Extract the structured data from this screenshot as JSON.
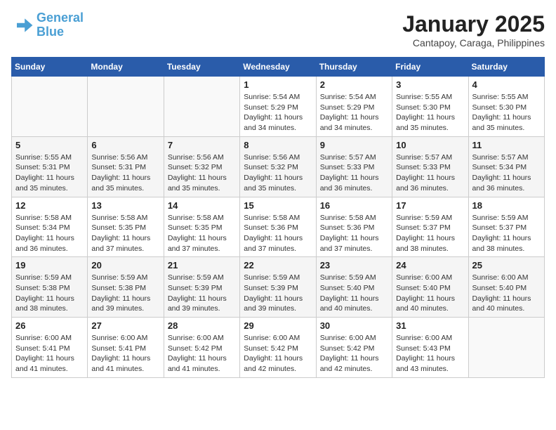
{
  "logo": {
    "line1": "General",
    "line2": "Blue"
  },
  "title": "January 2025",
  "location": "Cantapoy, Caraga, Philippines",
  "days_of_week": [
    "Sunday",
    "Monday",
    "Tuesday",
    "Wednesday",
    "Thursday",
    "Friday",
    "Saturday"
  ],
  "weeks": [
    [
      {
        "day": "",
        "info": ""
      },
      {
        "day": "",
        "info": ""
      },
      {
        "day": "",
        "info": ""
      },
      {
        "day": "1",
        "info": "Sunrise: 5:54 AM\nSunset: 5:29 PM\nDaylight: 11 hours and 34 minutes."
      },
      {
        "day": "2",
        "info": "Sunrise: 5:54 AM\nSunset: 5:29 PM\nDaylight: 11 hours and 34 minutes."
      },
      {
        "day": "3",
        "info": "Sunrise: 5:55 AM\nSunset: 5:30 PM\nDaylight: 11 hours and 35 minutes."
      },
      {
        "day": "4",
        "info": "Sunrise: 5:55 AM\nSunset: 5:30 PM\nDaylight: 11 hours and 35 minutes."
      }
    ],
    [
      {
        "day": "5",
        "info": "Sunrise: 5:55 AM\nSunset: 5:31 PM\nDaylight: 11 hours and 35 minutes."
      },
      {
        "day": "6",
        "info": "Sunrise: 5:56 AM\nSunset: 5:31 PM\nDaylight: 11 hours and 35 minutes."
      },
      {
        "day": "7",
        "info": "Sunrise: 5:56 AM\nSunset: 5:32 PM\nDaylight: 11 hours and 35 minutes."
      },
      {
        "day": "8",
        "info": "Sunrise: 5:56 AM\nSunset: 5:32 PM\nDaylight: 11 hours and 35 minutes."
      },
      {
        "day": "9",
        "info": "Sunrise: 5:57 AM\nSunset: 5:33 PM\nDaylight: 11 hours and 36 minutes."
      },
      {
        "day": "10",
        "info": "Sunrise: 5:57 AM\nSunset: 5:33 PM\nDaylight: 11 hours and 36 minutes."
      },
      {
        "day": "11",
        "info": "Sunrise: 5:57 AM\nSunset: 5:34 PM\nDaylight: 11 hours and 36 minutes."
      }
    ],
    [
      {
        "day": "12",
        "info": "Sunrise: 5:58 AM\nSunset: 5:34 PM\nDaylight: 11 hours and 36 minutes."
      },
      {
        "day": "13",
        "info": "Sunrise: 5:58 AM\nSunset: 5:35 PM\nDaylight: 11 hours and 37 minutes."
      },
      {
        "day": "14",
        "info": "Sunrise: 5:58 AM\nSunset: 5:35 PM\nDaylight: 11 hours and 37 minutes."
      },
      {
        "day": "15",
        "info": "Sunrise: 5:58 AM\nSunset: 5:36 PM\nDaylight: 11 hours and 37 minutes."
      },
      {
        "day": "16",
        "info": "Sunrise: 5:58 AM\nSunset: 5:36 PM\nDaylight: 11 hours and 37 minutes."
      },
      {
        "day": "17",
        "info": "Sunrise: 5:59 AM\nSunset: 5:37 PM\nDaylight: 11 hours and 38 minutes."
      },
      {
        "day": "18",
        "info": "Sunrise: 5:59 AM\nSunset: 5:37 PM\nDaylight: 11 hours and 38 minutes."
      }
    ],
    [
      {
        "day": "19",
        "info": "Sunrise: 5:59 AM\nSunset: 5:38 PM\nDaylight: 11 hours and 38 minutes."
      },
      {
        "day": "20",
        "info": "Sunrise: 5:59 AM\nSunset: 5:38 PM\nDaylight: 11 hours and 39 minutes."
      },
      {
        "day": "21",
        "info": "Sunrise: 5:59 AM\nSunset: 5:39 PM\nDaylight: 11 hours and 39 minutes."
      },
      {
        "day": "22",
        "info": "Sunrise: 5:59 AM\nSunset: 5:39 PM\nDaylight: 11 hours and 39 minutes."
      },
      {
        "day": "23",
        "info": "Sunrise: 5:59 AM\nSunset: 5:40 PM\nDaylight: 11 hours and 40 minutes."
      },
      {
        "day": "24",
        "info": "Sunrise: 6:00 AM\nSunset: 5:40 PM\nDaylight: 11 hours and 40 minutes."
      },
      {
        "day": "25",
        "info": "Sunrise: 6:00 AM\nSunset: 5:40 PM\nDaylight: 11 hours and 40 minutes."
      }
    ],
    [
      {
        "day": "26",
        "info": "Sunrise: 6:00 AM\nSunset: 5:41 PM\nDaylight: 11 hours and 41 minutes."
      },
      {
        "day": "27",
        "info": "Sunrise: 6:00 AM\nSunset: 5:41 PM\nDaylight: 11 hours and 41 minutes."
      },
      {
        "day": "28",
        "info": "Sunrise: 6:00 AM\nSunset: 5:42 PM\nDaylight: 11 hours and 41 minutes."
      },
      {
        "day": "29",
        "info": "Sunrise: 6:00 AM\nSunset: 5:42 PM\nDaylight: 11 hours and 42 minutes."
      },
      {
        "day": "30",
        "info": "Sunrise: 6:00 AM\nSunset: 5:42 PM\nDaylight: 11 hours and 42 minutes."
      },
      {
        "day": "31",
        "info": "Sunrise: 6:00 AM\nSunset: 5:43 PM\nDaylight: 11 hours and 43 minutes."
      },
      {
        "day": "",
        "info": ""
      }
    ]
  ]
}
